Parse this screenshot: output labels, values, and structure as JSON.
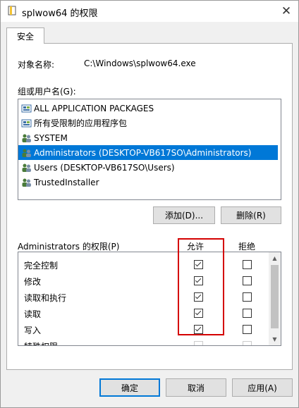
{
  "title": "splwow64 的权限",
  "tab_label": "安全",
  "object_label": "对象名称:",
  "object_value": "C:\\Windows\\splwow64.exe",
  "groups_label": "组或用户名(G):",
  "groups": [
    {
      "label": "ALL APPLICATION PACKAGES",
      "icon": "app-package-icon"
    },
    {
      "label": "所有受限制的应用程序包",
      "icon": "app-package-icon"
    },
    {
      "label": "SYSTEM",
      "icon": "users-icon"
    },
    {
      "label": "Administrators (DESKTOP-VB617SO\\Administrators)",
      "icon": "users-icon",
      "selected": true
    },
    {
      "label": "Users (DESKTOP-VB617SO\\Users)",
      "icon": "users-icon"
    },
    {
      "label": "TrustedInstaller",
      "icon": "users-icon"
    }
  ],
  "add_button": "添加(D)...",
  "remove_button": "删除(R)",
  "perm_label": "Administrators 的权限(P)",
  "allow_label": "允许",
  "deny_label": "拒绝",
  "permissions": [
    {
      "label": "完全控制",
      "allow": true,
      "deny": false
    },
    {
      "label": "修改",
      "allow": true,
      "deny": false
    },
    {
      "label": "读取和执行",
      "allow": true,
      "deny": false
    },
    {
      "label": "读取",
      "allow": true,
      "deny": false
    },
    {
      "label": "写入",
      "allow": true,
      "deny": false
    },
    {
      "label": "特殊权限",
      "allow": false,
      "deny": false
    }
  ],
  "ok_button": "确定",
  "cancel_button": "取消",
  "apply_button": "应用(A)",
  "colors": {
    "selection": "#0078d7",
    "highlight_box": "#d40000"
  }
}
